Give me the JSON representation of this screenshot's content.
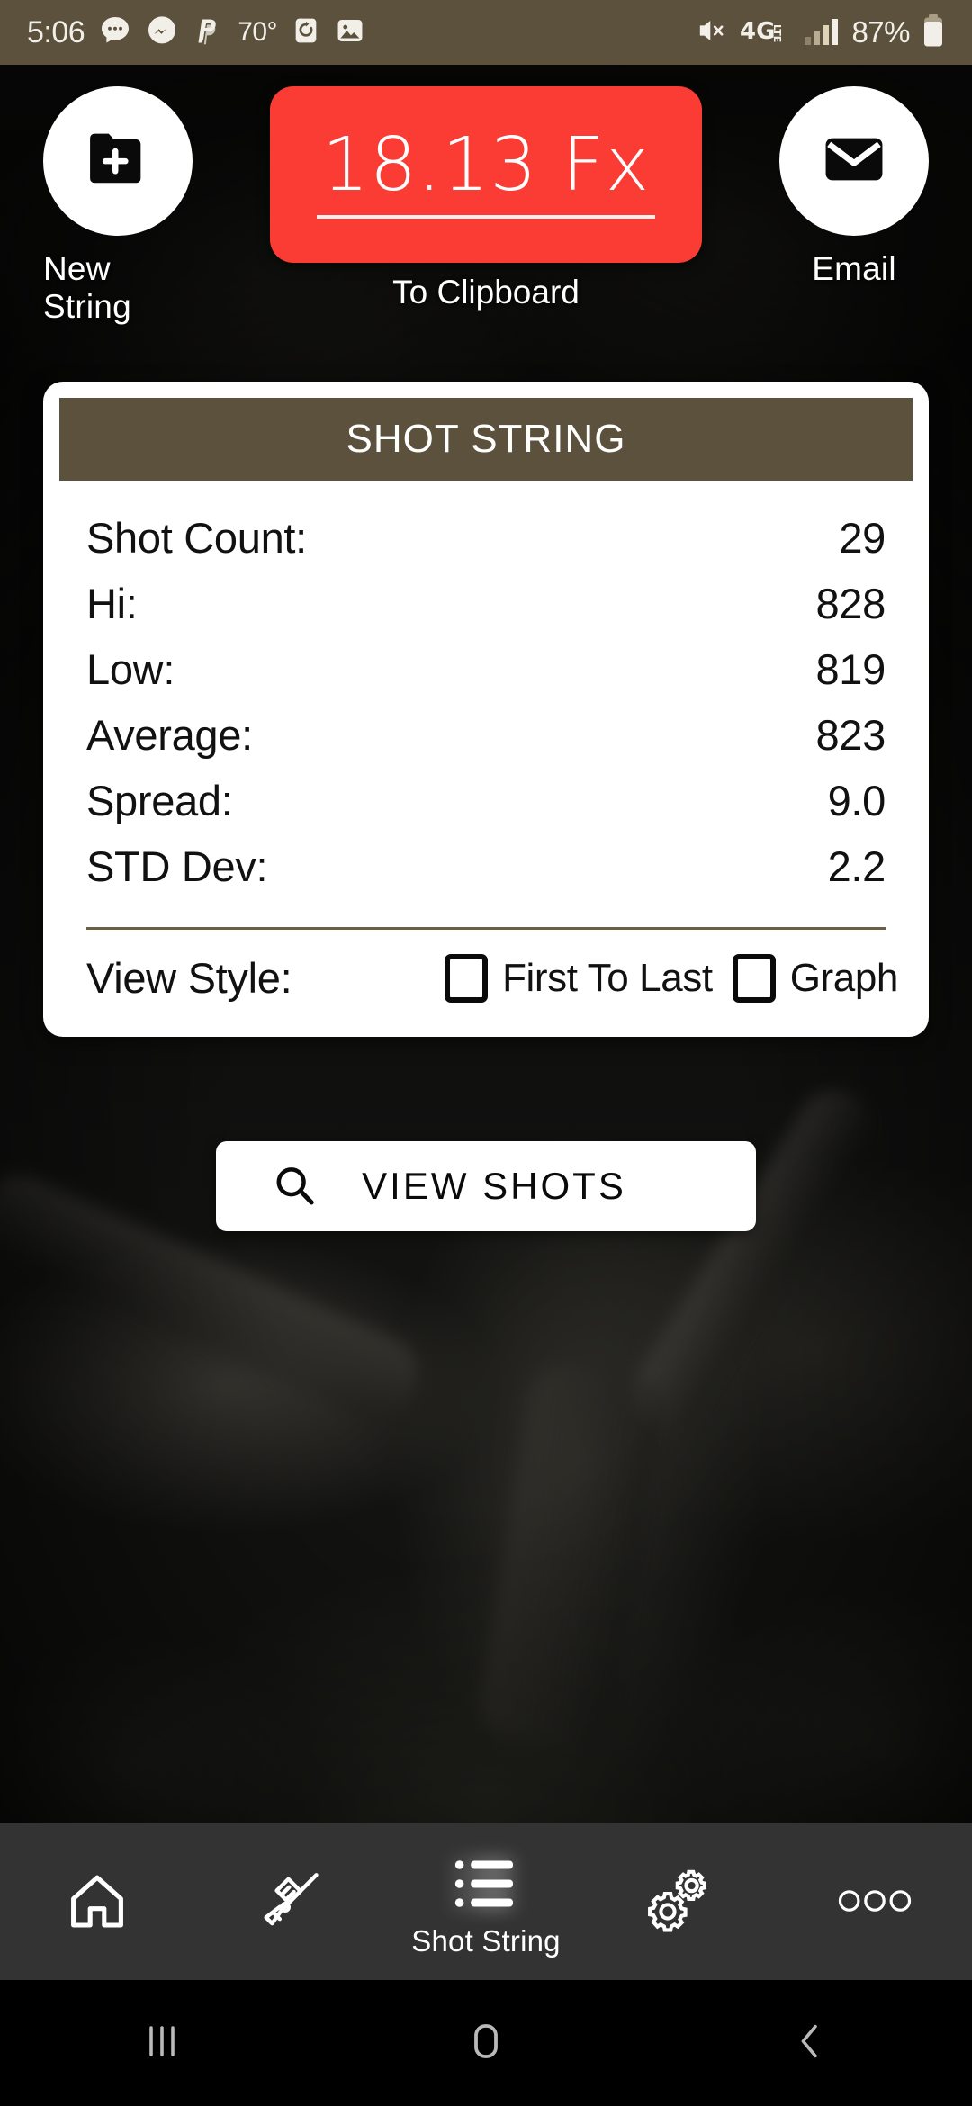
{
  "status_bar": {
    "clock": "5:06",
    "temperature": "70°",
    "battery_percent": "87%",
    "network": "4G LTE",
    "icons": [
      "sms-icon",
      "messenger-icon",
      "paypal-icon",
      "alarm-reset-icon",
      "photo-icon",
      "mute-icon",
      "network-4glte-icon",
      "signal-bars-icon",
      "battery-icon"
    ],
    "background_color": "#5b513c"
  },
  "top_actions": {
    "new_string": {
      "label": "New String",
      "icon": "folder-plus-icon"
    },
    "clipboard": {
      "value": "18.13 Fx",
      "label": "To Clipboard",
      "color": "#fa3c35"
    },
    "email": {
      "label": "Email",
      "icon": "envelope-icon"
    }
  },
  "shot_card": {
    "header_title": "SHOT STRING",
    "header_color": "#5b513c",
    "stats": [
      {
        "label": "Shot Count:",
        "value": "29"
      },
      {
        "label": "Hi:",
        "value": "828"
      },
      {
        "label": "Low:",
        "value": "819"
      },
      {
        "label": "Average:",
        "value": "823"
      },
      {
        "label": "Spread:",
        "value": "9.0"
      },
      {
        "label": "STD Dev:",
        "value": "2.2"
      }
    ],
    "view_style": {
      "label": "View Style:",
      "options": [
        {
          "label": "First To Last",
          "checked": false
        },
        {
          "label": "Graph",
          "checked": false
        }
      ]
    }
  },
  "view_shots_button": {
    "label": "VIEW SHOTS",
    "icon": "search-icon"
  },
  "app_nav": {
    "items": [
      {
        "label": "",
        "icon": "home-icon",
        "active": false
      },
      {
        "label": "",
        "icon": "rifle-icon",
        "active": false
      },
      {
        "label": "Shot String",
        "icon": "list-icon",
        "active": true
      },
      {
        "label": "",
        "icon": "gears-icon",
        "active": false
      },
      {
        "label": "",
        "icon": "more-dots-icon",
        "active": false
      }
    ]
  },
  "system_nav": {
    "recents": "recents-icon",
    "home": "home-square-icon",
    "back": "back-chevron-icon"
  }
}
